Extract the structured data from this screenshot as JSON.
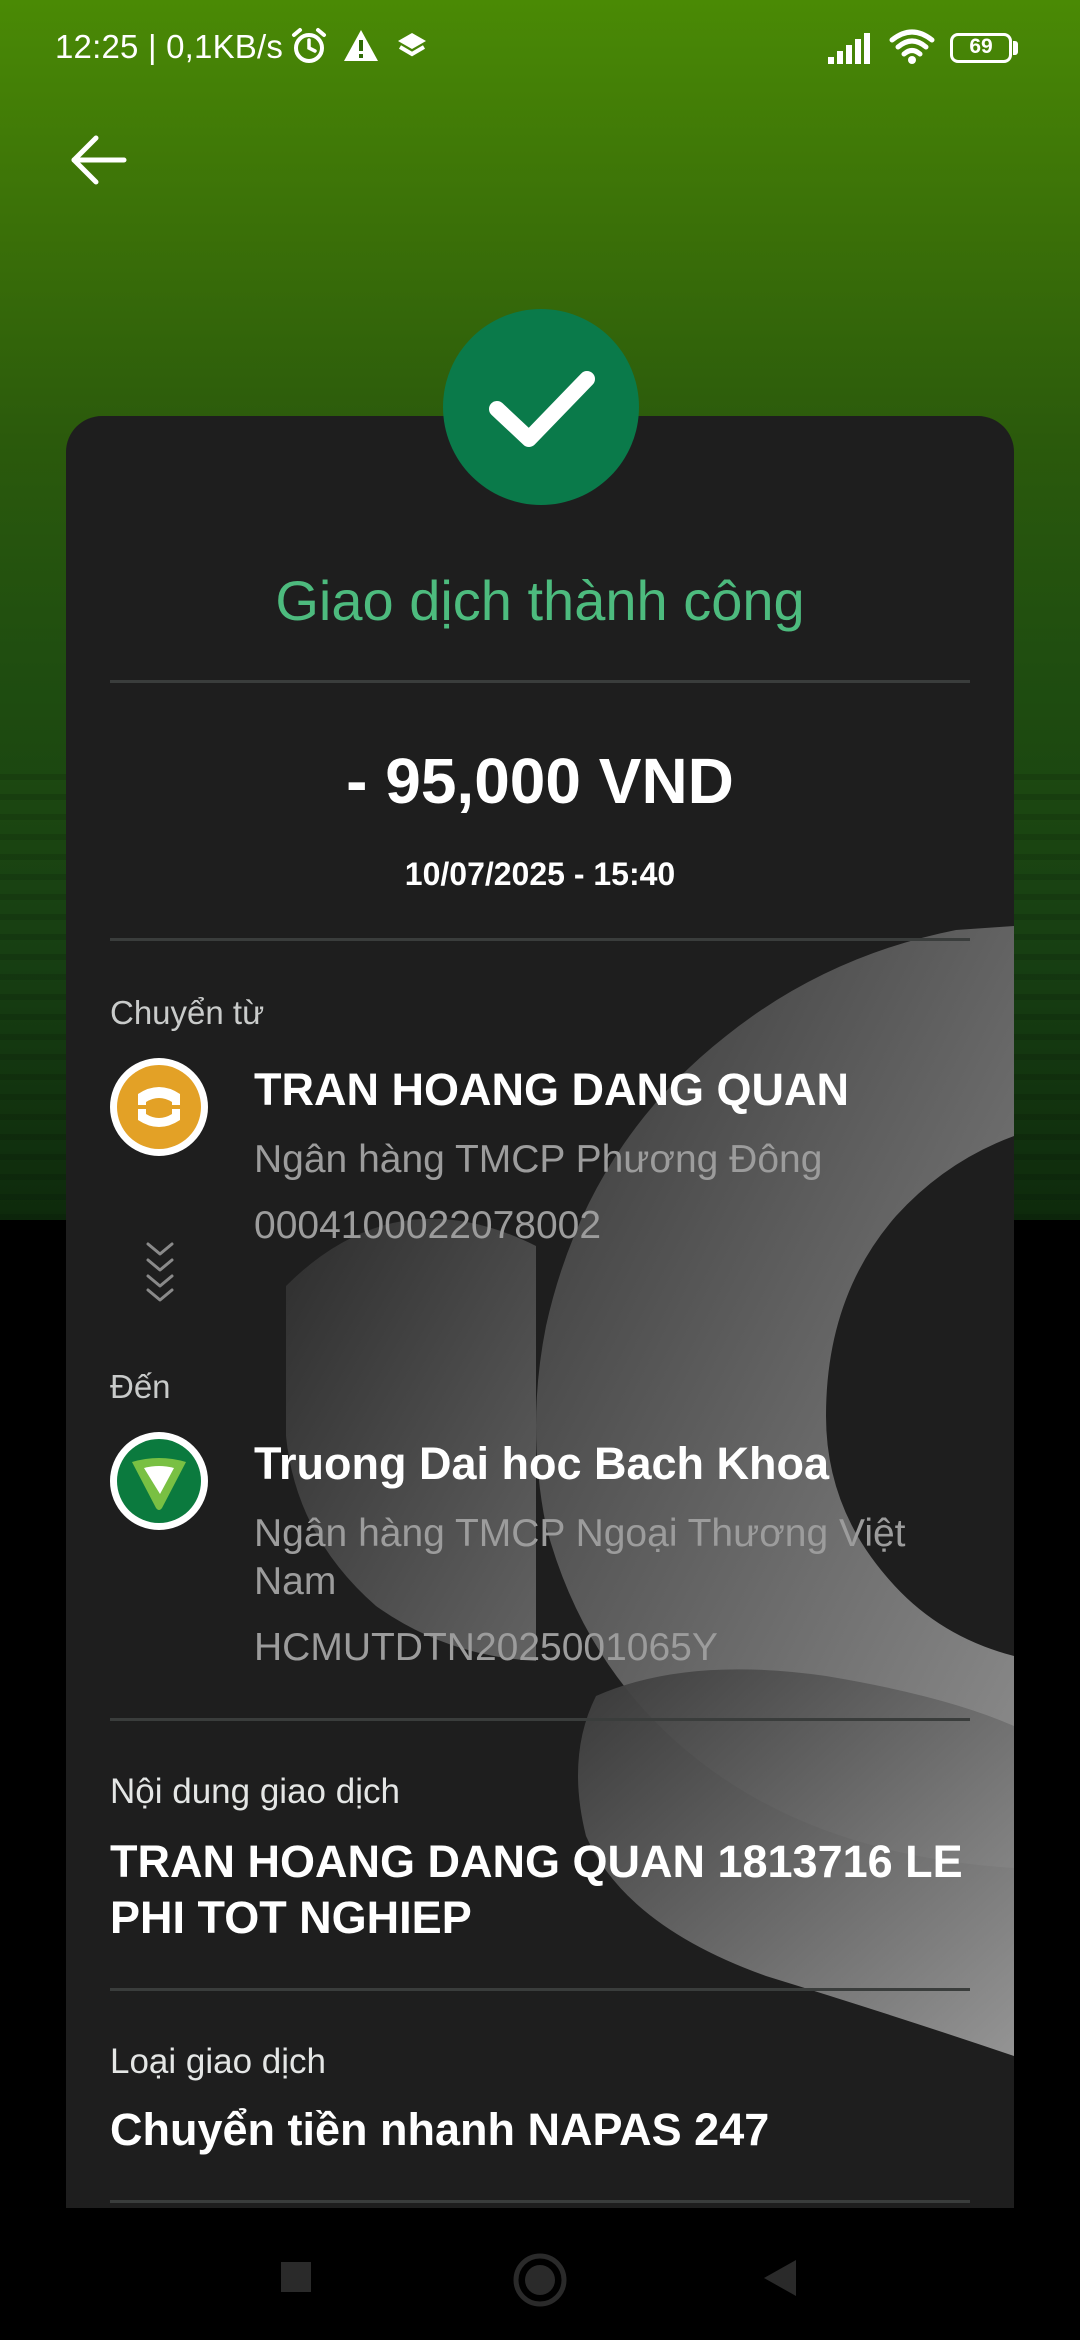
{
  "status_bar": {
    "time": "12:25 | 0,1KB/s",
    "battery": "69"
  },
  "header": {
    "back_icon": "arrow-left-icon"
  },
  "result": {
    "icon": "checkmark-icon",
    "title": "Giao dịch thành công",
    "amount": "- 95,000 VND",
    "datetime": "10/07/2025 - 15:40"
  },
  "from": {
    "label": "Chuyển từ",
    "name": "TRAN HOANG DANG QUAN",
    "bank": "Ngân hàng TMCP Phương Đông",
    "account": "0004100022078002"
  },
  "to": {
    "label": "Đến",
    "name": "Truong Dai hoc Bach Khoa",
    "bank": "Ngân hàng TMCP Ngoại Thương Việt Nam",
    "account": "HCMUTDTN2025001065Y"
  },
  "details": {
    "content_label": "Nội dung giao dịch",
    "content_value": "TRAN HOANG DANG QUAN 1813716 LE PHI TOT NGHIEP",
    "type_label": "Loại giao dịch",
    "type_value": "Chuyển tiền nhanh NAPAS 247"
  },
  "colors": {
    "accent_green": "#4dbb7e",
    "success_circle": "#0a7a4a",
    "card_bg": "#1e1e1e",
    "top_green": "#4a8a05"
  }
}
